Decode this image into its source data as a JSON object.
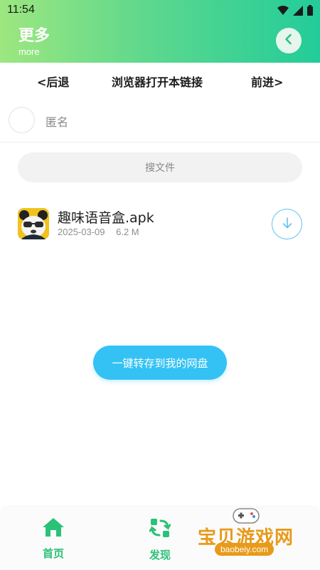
{
  "status_bar": {
    "time": "11:54"
  },
  "header": {
    "title": "更多",
    "subtitle": "more",
    "accent_gradient": [
      "#9de77f",
      "#22cc9a"
    ]
  },
  "nav": {
    "back_label": "<后退",
    "open_label": "浏览器打开本链接",
    "forward_label": "前进>"
  },
  "user": {
    "name": "匿名"
  },
  "search": {
    "placeholder": "搜文件"
  },
  "file": {
    "name": "趣味语音盒.apk",
    "date": "2025-03-09",
    "size": "6.2 M",
    "icon": "panda-app-icon"
  },
  "save_button": {
    "label": "一键转存到我的网盘",
    "color": "#34c2f4"
  },
  "bottom_nav": {
    "tabs": [
      {
        "label": "首页",
        "icon": "home-icon"
      },
      {
        "label": "发现",
        "icon": "discover-icon"
      }
    ],
    "active_color": "#2ac178"
  },
  "watermark": {
    "text": "宝贝游戏网",
    "url": "baobeiy.com"
  }
}
